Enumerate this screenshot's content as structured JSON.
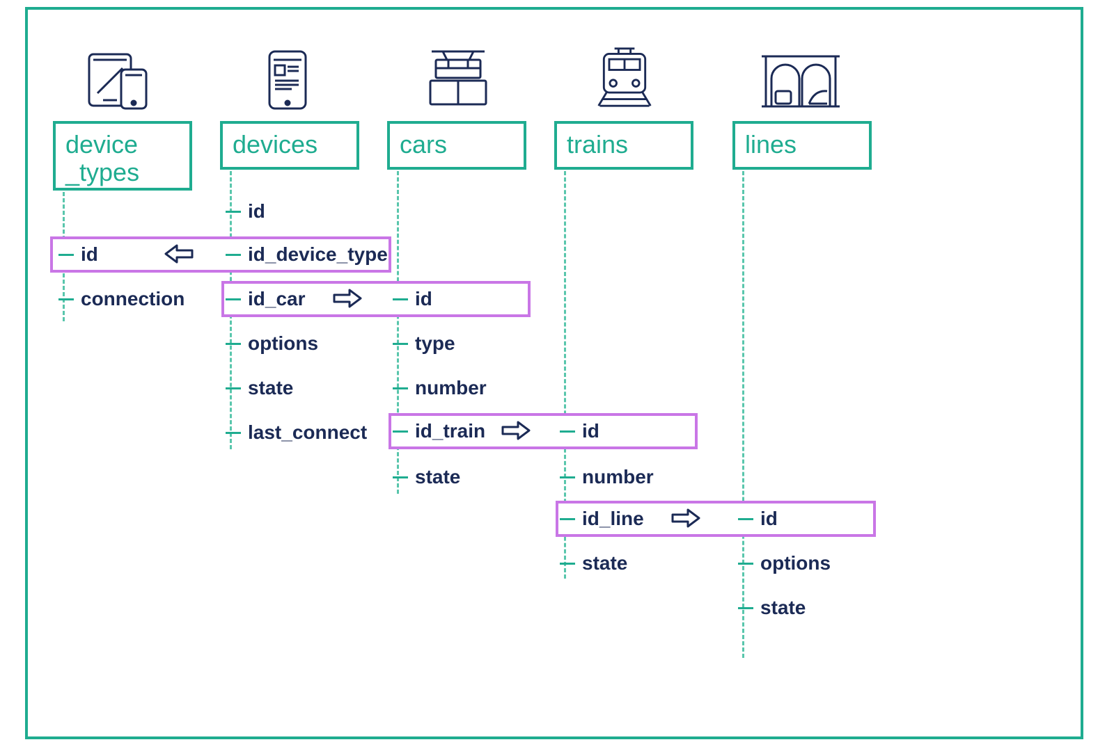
{
  "entities": {
    "device_types": {
      "label_line1": "device",
      "label_line2": "_types",
      "fields": [
        "id",
        "connection"
      ]
    },
    "devices": {
      "label": "devices",
      "fields": [
        "id",
        "id_device_type",
        "id_car",
        "options",
        "state",
        "last_connect"
      ]
    },
    "cars": {
      "label": "cars",
      "fields": [
        "id",
        "type",
        "number",
        "id_train",
        "state"
      ]
    },
    "trains": {
      "label": "trains",
      "fields": [
        "id",
        "number",
        "id_line",
        "state"
      ]
    },
    "lines": {
      "label": "lines",
      "fields": [
        "id",
        "options",
        "state"
      ]
    }
  },
  "relations": [
    {
      "from_table": "devices",
      "from_field": "id_device_type",
      "to_table": "device_types",
      "to_field": "id",
      "direction": "left"
    },
    {
      "from_table": "devices",
      "from_field": "id_car",
      "to_table": "cars",
      "to_field": "id",
      "direction": "right"
    },
    {
      "from_table": "cars",
      "from_field": "id_train",
      "to_table": "trains",
      "to_field": "id",
      "direction": "right"
    },
    {
      "from_table": "trains",
      "from_field": "id_line",
      "to_table": "lines",
      "to_field": "id",
      "direction": "right"
    }
  ],
  "colors": {
    "teal": "#1fac90",
    "navy": "#1b2a55",
    "violet": "#c976e6"
  }
}
